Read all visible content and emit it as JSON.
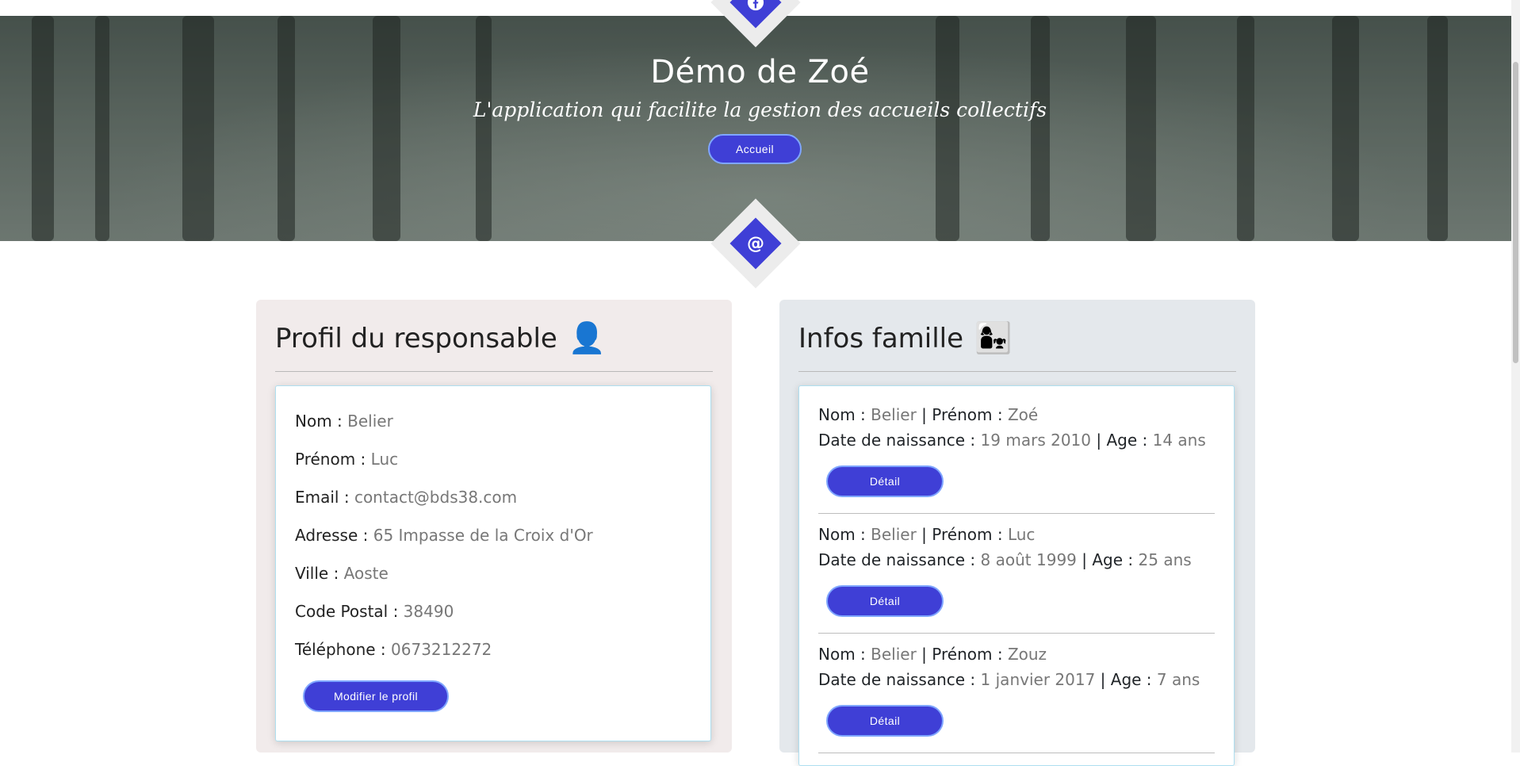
{
  "hero": {
    "title": "Démo de Zoé",
    "subtitle": "L'application qui facilite la gestion des accueils collectifs",
    "home_button": "Accueil",
    "top_icon": "facebook-icon",
    "bottom_icon": "at-icon",
    "bottom_icon_glyph": "@",
    "top_icon_glyph": "f"
  },
  "profile": {
    "title": "Profil du responsable",
    "emoji": "👤",
    "fields": [
      {
        "label": "Nom :",
        "value": "Belier"
      },
      {
        "label": "Prénom :",
        "value": "Luc"
      },
      {
        "label": "Email :",
        "value": "contact@bds38.com"
      },
      {
        "label": "Adresse :",
        "value": "65 Impasse de la Croix d'Or"
      },
      {
        "label": "Ville :",
        "value": "Aoste"
      },
      {
        "label": "Code Postal :",
        "value": "38490"
      },
      {
        "label": "Téléphone :",
        "value": "0673212272"
      }
    ],
    "edit_button": "Modifier le profil"
  },
  "family": {
    "title": "Infos famille",
    "emoji": "👩‍👧",
    "labels": {
      "nom": "Nom :",
      "prenom": "Prénom :",
      "naissance": "Date de naissance :",
      "age": "Age :",
      "sep": "|"
    },
    "detail_button": "Détail",
    "members": [
      {
        "nom": "Belier",
        "prenom": "Zoé",
        "naissance": "19 mars 2010",
        "age": "14 ans"
      },
      {
        "nom": "Belier",
        "prenom": "Luc",
        "naissance": "8 août 1999",
        "age": "25 ans"
      },
      {
        "nom": "Belier",
        "prenom": "Zouz",
        "naissance": "1 janvier 2017",
        "age": "7 ans"
      }
    ]
  },
  "colors": {
    "accent": "#3f3fd6",
    "left_panel_bg": "#f1ebeb",
    "right_panel_bg": "#e4e8ec"
  }
}
